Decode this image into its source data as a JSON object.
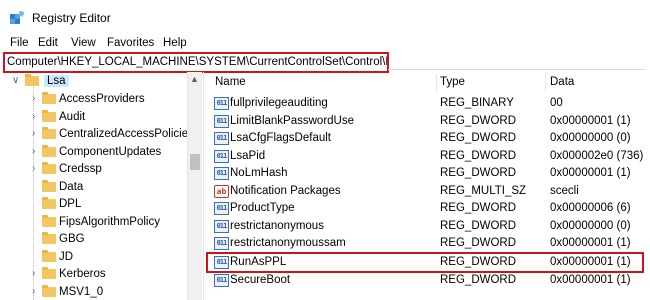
{
  "window": {
    "title": "Registry Editor"
  },
  "menu": [
    "File",
    "Edit",
    "View",
    "Favorites",
    "Help"
  ],
  "address": {
    "path": "Computer\\HKEY_LOCAL_MACHINE\\SYSTEM\\CurrentControlSet\\Control\\Lsa"
  },
  "tree": {
    "selected": "Lsa",
    "items": [
      {
        "label": "AccessProviders",
        "expandable": true
      },
      {
        "label": "Audit",
        "expandable": true
      },
      {
        "label": "CentralizedAccessPolicies",
        "expandable": true
      },
      {
        "label": "ComponentUpdates",
        "expandable": true
      },
      {
        "label": "Credssp",
        "expandable": true
      },
      {
        "label": "Data",
        "expandable": false
      },
      {
        "label": "DPL",
        "expandable": false
      },
      {
        "label": "FipsAlgorithmPolicy",
        "expandable": false
      },
      {
        "label": "GBG",
        "expandable": false
      },
      {
        "label": "JD",
        "expandable": false
      },
      {
        "label": "Kerberos",
        "expandable": true
      },
      {
        "label": "MSV1_0",
        "expandable": true
      }
    ]
  },
  "columns": {
    "name": "Name",
    "type": "Type",
    "data": "Data"
  },
  "values": [
    {
      "icon": "binary-value-icon",
      "name": "fullprivilegeauditing",
      "type": "REG_BINARY",
      "data": "00"
    },
    {
      "icon": "binary-value-icon",
      "name": "LimitBlankPasswordUse",
      "type": "REG_DWORD",
      "data": "0x00000001 (1)"
    },
    {
      "icon": "binary-value-icon",
      "name": "LsaCfgFlagsDefault",
      "type": "REG_DWORD",
      "data": "0x00000000 (0)"
    },
    {
      "icon": "binary-value-icon",
      "name": "LsaPid",
      "type": "REG_DWORD",
      "data": "0x000002e0 (736)"
    },
    {
      "icon": "binary-value-icon",
      "name": "NoLmHash",
      "type": "REG_DWORD",
      "data": "0x00000001 (1)"
    },
    {
      "icon": "string-value-icon",
      "name": "Notification Packages",
      "type": "REG_MULTI_SZ",
      "data": "scecli"
    },
    {
      "icon": "binary-value-icon",
      "name": "ProductType",
      "type": "REG_DWORD",
      "data": "0x00000006 (6)"
    },
    {
      "icon": "binary-value-icon",
      "name": "restrictanonymous",
      "type": "REG_DWORD",
      "data": "0x00000000 (0)"
    },
    {
      "icon": "binary-value-icon",
      "name": "restrictanonymoussam",
      "type": "REG_DWORD",
      "data": "0x00000001 (1)"
    },
    {
      "icon": "binary-value-icon",
      "name": "RunAsPPL",
      "type": "REG_DWORD",
      "data": "0x00000001 (1)"
    },
    {
      "icon": "binary-value-icon",
      "name": "SecureBoot",
      "type": "REG_DWORD",
      "data": "0x00000001 (1)"
    }
  ],
  "colors": {
    "highlight": "#d0121b",
    "selection": "#cce8ff",
    "folder": "#f2c660"
  }
}
